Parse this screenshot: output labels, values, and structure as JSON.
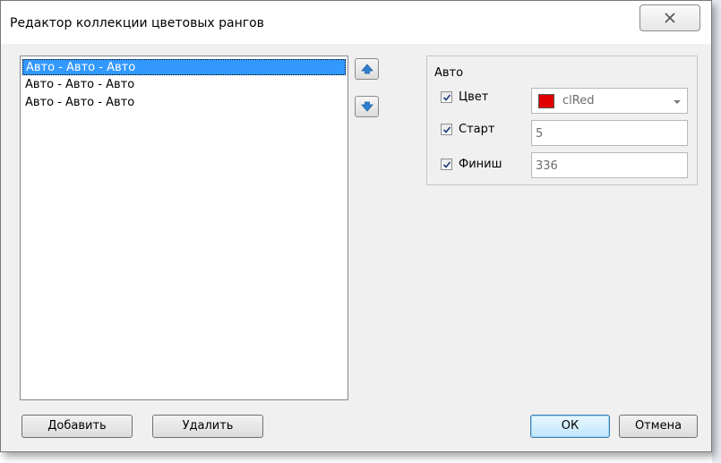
{
  "window": {
    "title": "Редактор коллекции цветовых рангов",
    "close_symbol": "☒"
  },
  "list": {
    "items": [
      {
        "label": "Авто - Авто - Авто",
        "selected": true
      },
      {
        "label": "Авто - Авто - Авто",
        "selected": false
      },
      {
        "label": "Авто - Авто - Авто",
        "selected": false
      }
    ]
  },
  "properties": {
    "group_label": "Авто",
    "color": {
      "label": "Цвет",
      "checked": true,
      "value": "clRed",
      "swatch": "#e00000"
    },
    "start": {
      "label": "Старт",
      "checked": true,
      "value": "5"
    },
    "finish": {
      "label": "Финиш",
      "checked": true,
      "value": "336"
    }
  },
  "buttons": {
    "add": "Добавить",
    "delete": "Удалить",
    "ok": "ОК",
    "cancel": "Отмена"
  },
  "colors": {
    "selection": "#3399ff",
    "arrow_icon": "#2f7fd0"
  }
}
